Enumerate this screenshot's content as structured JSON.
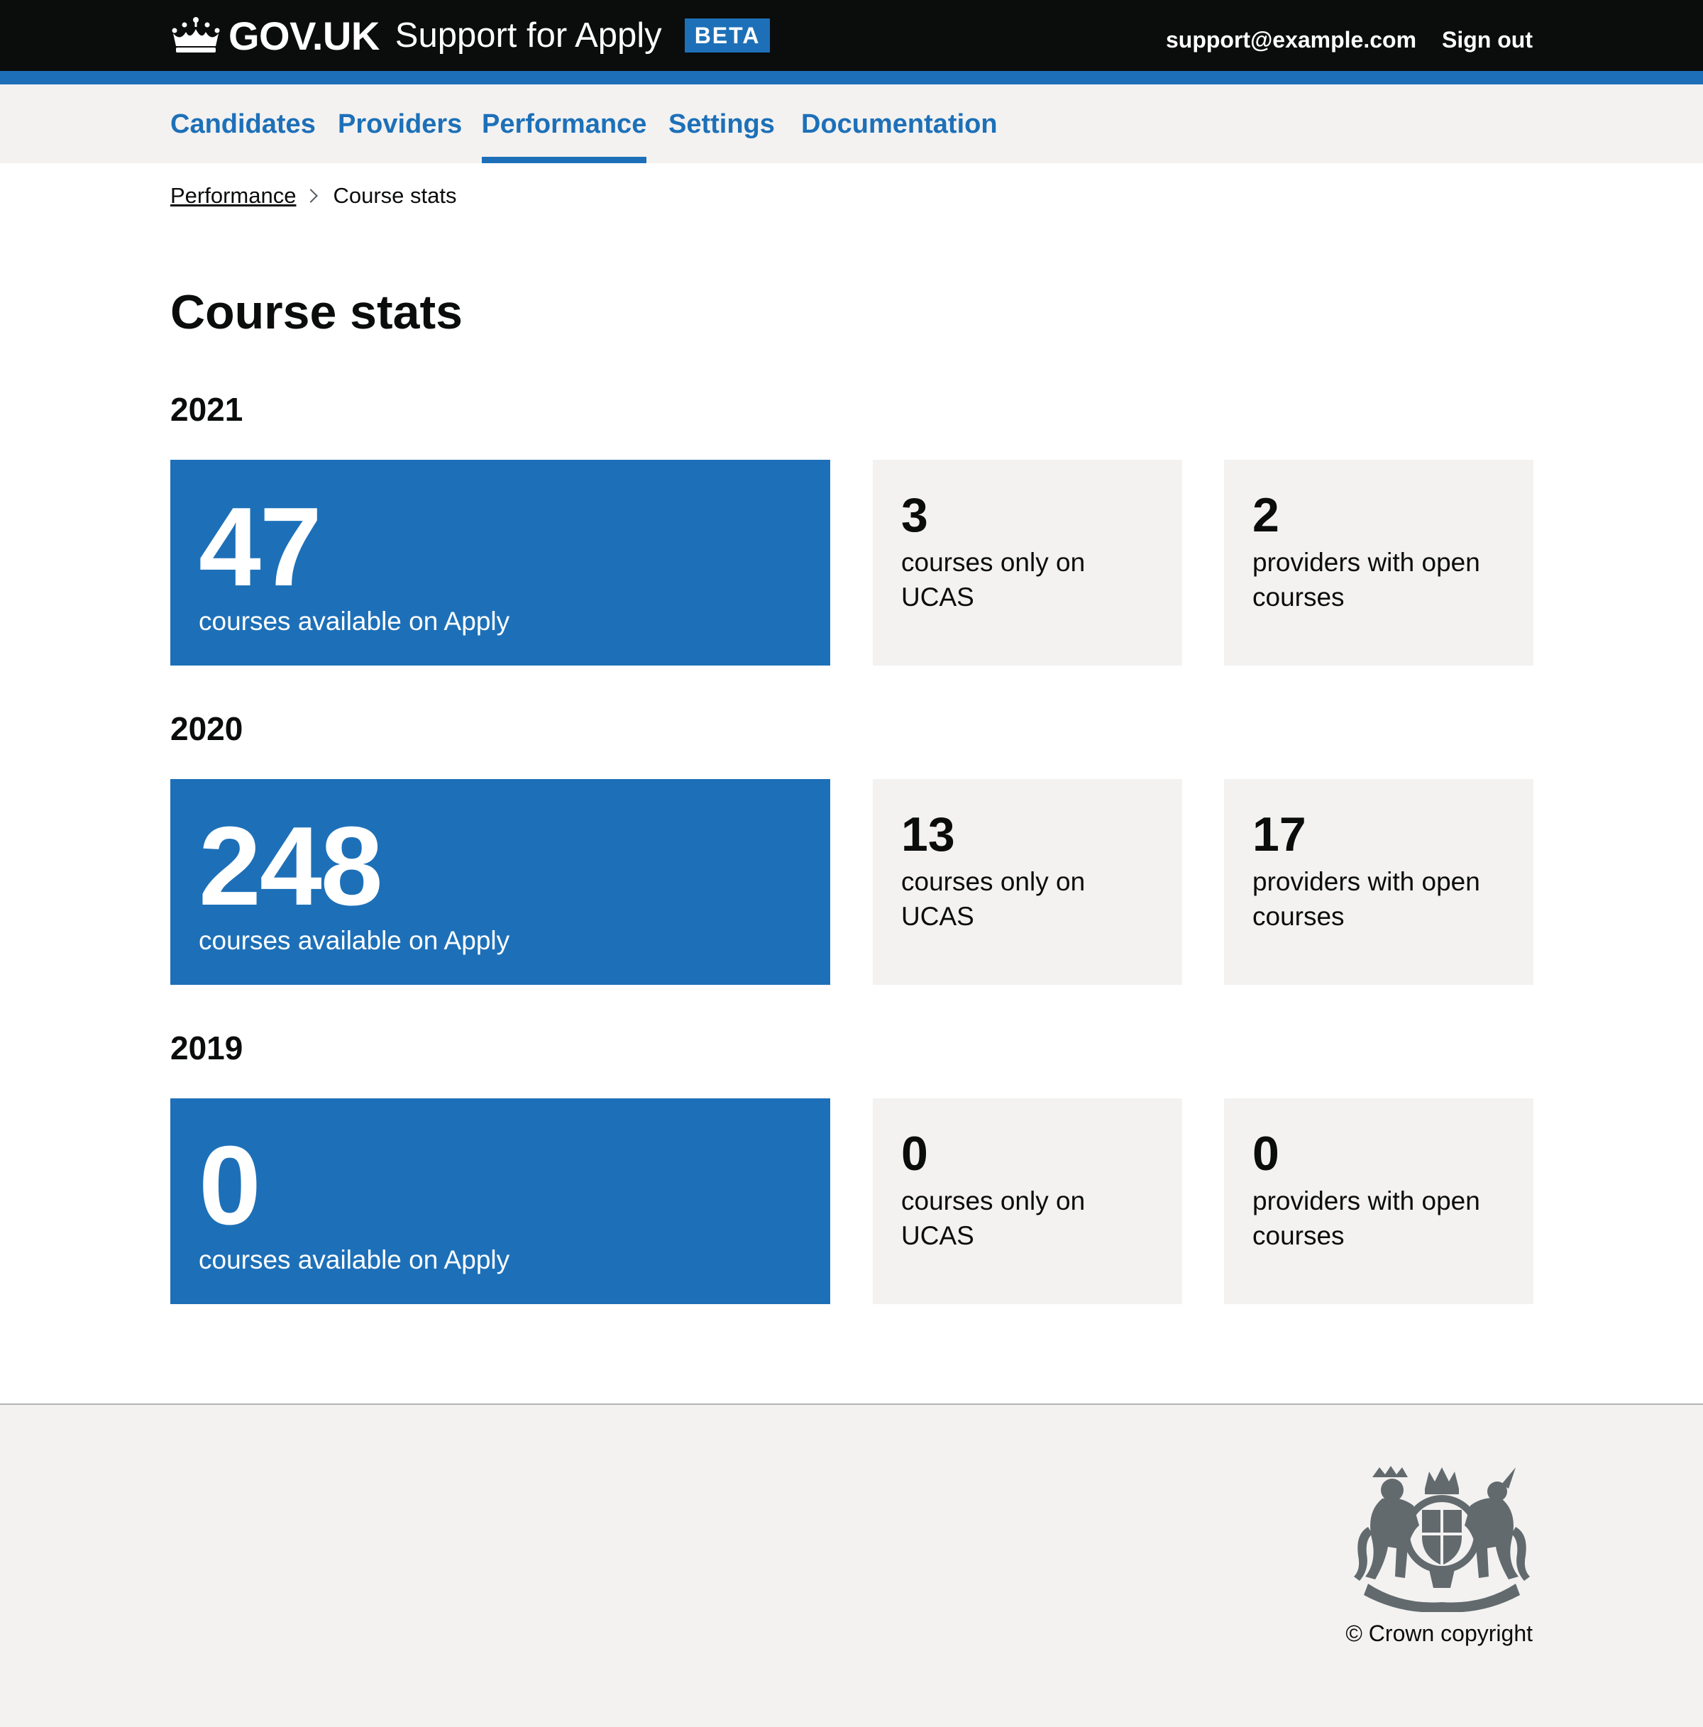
{
  "header": {
    "brand": "GOV.UK",
    "service_name": "Support for Apply",
    "phase_tag": "BETA",
    "user_email": "support@example.com",
    "sign_out": "Sign out"
  },
  "nav": {
    "items": [
      {
        "label": "Candidates",
        "active": false
      },
      {
        "label": "Providers",
        "active": false
      },
      {
        "label": "Performance",
        "active": true
      },
      {
        "label": "Settings",
        "active": false
      },
      {
        "label": "Documentation",
        "active": false
      }
    ]
  },
  "breadcrumb": {
    "parent": "Performance",
    "current": "Course stats"
  },
  "page_title": "Course stats",
  "years": [
    {
      "year": "2021",
      "apply_courses": {
        "value": "47",
        "label": "courses available on Apply"
      },
      "ucas_only": {
        "value": "3",
        "label": "courses only on UCAS"
      },
      "providers_open": {
        "value": "2",
        "label": "providers with open courses"
      }
    },
    {
      "year": "2020",
      "apply_courses": {
        "value": "248",
        "label": "courses available on Apply"
      },
      "ucas_only": {
        "value": "13",
        "label": "courses only on UCAS"
      },
      "providers_open": {
        "value": "17",
        "label": "providers with open courses"
      }
    },
    {
      "year": "2019",
      "apply_courses": {
        "value": "0",
        "label": "courses available on Apply"
      },
      "ucas_only": {
        "value": "0",
        "label": "courses only on UCAS"
      },
      "providers_open": {
        "value": "0",
        "label": "providers with open courses"
      }
    }
  ],
  "footer": {
    "copyright": "© Crown copyright",
    "crest_icon": "royal-coat-of-arms-icon"
  },
  "colors": {
    "header_bg": "#0b0c0c",
    "brand_blue": "#1d70b8",
    "panel_grey": "#f3f2f1",
    "text": "#0b0c0c",
    "crest_grey": "#626a6e"
  }
}
